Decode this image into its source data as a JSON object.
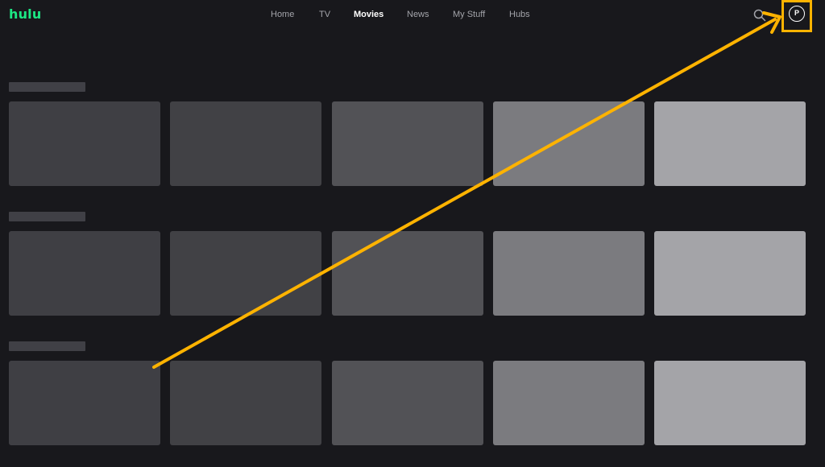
{
  "brand": {
    "logo_text": "hulu",
    "logo_color": "#1ce783"
  },
  "nav": {
    "items": [
      {
        "label": "Home",
        "active": false
      },
      {
        "label": "TV",
        "active": false
      },
      {
        "label": "Movies",
        "active": true
      },
      {
        "label": "News",
        "active": false
      },
      {
        "label": "My Stuff",
        "active": false
      },
      {
        "label": "Hubs",
        "active": false
      }
    ]
  },
  "header_actions": {
    "search_icon": "search-icon",
    "profile_initial": "P"
  },
  "annotation": {
    "color": "#ffb300",
    "target": "profile-button"
  },
  "content": {
    "rows": [
      {
        "tiles": 5
      },
      {
        "tiles": 5
      },
      {
        "tiles": 5
      }
    ]
  },
  "colors": {
    "background": "#18181c",
    "nav_text": "#a3a4aa",
    "nav_active": "#ffffff"
  }
}
